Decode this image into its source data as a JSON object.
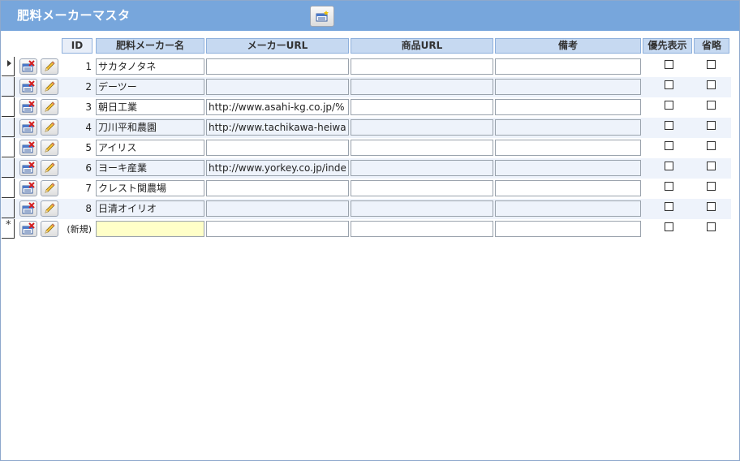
{
  "title": "肥料メーカーマスタ",
  "columns": {
    "id": "ID",
    "name": "肥料メーカー名",
    "maker_url": "メーカーURL",
    "product_url": "商品URL",
    "note": "備考",
    "priority": "優先表示",
    "omit": "省略"
  },
  "rows": [
    {
      "id": "1",
      "name": "サカタノタネ",
      "maker_url": "",
      "product_url": "",
      "note": "",
      "priority": false,
      "omit": false
    },
    {
      "id": "2",
      "name": "デーツー",
      "maker_url": "",
      "product_url": "",
      "note": "",
      "priority": false,
      "omit": false
    },
    {
      "id": "3",
      "name": "朝日工業",
      "maker_url": "http://www.asahi-kg.co.jp/%",
      "product_url": "",
      "note": "",
      "priority": false,
      "omit": false
    },
    {
      "id": "4",
      "name": "刀川平和農園",
      "maker_url": "http://www.tachikawa-heiwa",
      "product_url": "",
      "note": "",
      "priority": false,
      "omit": false
    },
    {
      "id": "5",
      "name": "アイリス",
      "maker_url": "",
      "product_url": "",
      "note": "",
      "priority": false,
      "omit": false
    },
    {
      "id": "6",
      "name": "ヨーキ産業",
      "maker_url": "http://www.yorkey.co.jp/inde",
      "product_url": "",
      "note": "",
      "priority": false,
      "omit": false
    },
    {
      "id": "7",
      "name": "クレスト関農場",
      "maker_url": "",
      "product_url": "",
      "note": "",
      "priority": false,
      "omit": false
    },
    {
      "id": "8",
      "name": "日清オイリオ",
      "maker_url": "",
      "product_url": "",
      "note": "",
      "priority": false,
      "omit": false
    }
  ],
  "new_row": {
    "id": "(新規)",
    "name": "",
    "maker_url": "",
    "product_url": "",
    "note": ""
  },
  "icons": {
    "toolbar": "new-record-icon",
    "row_left": "delete-record-icon",
    "row_right": "edit-pencil-icon"
  },
  "colors": {
    "titlebar": "#77a6dc",
    "header": "#c6d9f1",
    "new_field": "#ffffc8"
  }
}
